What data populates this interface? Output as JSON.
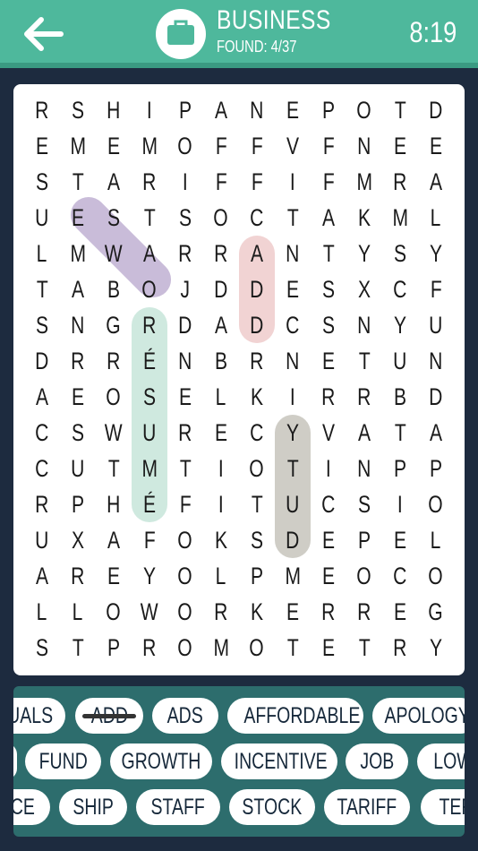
{
  "header": {
    "back_icon": "arrow-left-icon",
    "category_icon": "briefcase-icon",
    "category": "BUSINESS",
    "found": "FOUND: 4/37",
    "timer": "8:19",
    "colors": {
      "bar": "#4eb89c",
      "background": "#1d2b3f"
    }
  },
  "grid": {
    "rows": [
      "RSHIPANEPOTD",
      "EMEMOFFVFNEE",
      "STARIFFIFMRA",
      "UESTSOCTAKML",
      "LMWARRANTYSY",
      "TABOJDDESXCF",
      "SNGRDADCSNYU",
      "DRRÉNBRNETUN",
      "AEOSELKIRRBD",
      "CSWUREC YVATA",
      "CUTMTIOTINPP",
      "RPHÉFITUCSIO",
      "UXAFOKSDEPEL",
      "AREYOLPMEOCO",
      "LLOWORKERREG",
      "STPROMOTETRY"
    ]
  },
  "highlights": [
    {
      "word": "ESTO",
      "color": "#c9bcd9"
    },
    {
      "word": "ADD",
      "color": "#f1d3d3"
    },
    {
      "word": "RÉSUMÉ",
      "color": "#cfe9df"
    },
    {
      "word": "YTUD",
      "color": "#cfcdc6"
    }
  ],
  "words": {
    "row1": [
      "UALS",
      "ADD",
      "ADS",
      "AFFORDABLE",
      "APOLOGY"
    ],
    "row2": [
      "",
      "FUND",
      "GROWTH",
      "INCENTIVE",
      "JOB",
      "LOW"
    ],
    "row3": [
      "CE",
      "SHIP",
      "STAFF",
      "STOCK",
      "TARIFF",
      "TER"
    ],
    "found_words": [
      "ADD"
    ]
  }
}
